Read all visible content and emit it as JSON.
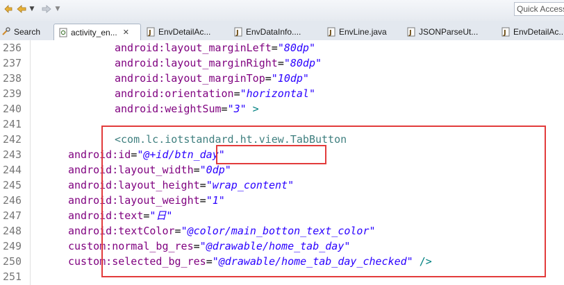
{
  "toolbar": {
    "quick_access": "Quick Access"
  },
  "tabs": [
    {
      "label": "Search",
      "icon": "search-icon",
      "active": false
    },
    {
      "label": "activity_en...",
      "icon": "xml-file-icon",
      "active": true
    },
    {
      "label": "EnvDetailAc...",
      "icon": "java-file-icon",
      "active": false
    },
    {
      "label": "EnvDataInfo....",
      "icon": "java-file-icon",
      "active": false
    },
    {
      "label": "EnvLine.java",
      "icon": "java-file-icon",
      "active": false
    },
    {
      "label": "JSONParseUt...",
      "icon": "java-file-icon",
      "active": false
    },
    {
      "label": "EnvDetailAc...",
      "icon": "java-file-icon",
      "active": false
    }
  ],
  "code_lines": [
    {
      "num": "236",
      "indent": 3,
      "attr": "android:layout_marginLeft",
      "value": "\"80dp\"",
      "suffix": ""
    },
    {
      "num": "237",
      "indent": 3,
      "attr": "android:layout_marginRight",
      "value": "\"80dp\"",
      "suffix": ""
    },
    {
      "num": "238",
      "indent": 3,
      "attr": "android:layout_marginTop",
      "value": "\"10dp\"",
      "suffix": ""
    },
    {
      "num": "239",
      "indent": 3,
      "attr": "android:orientation",
      "value": "\"horizontal\"",
      "suffix": ""
    },
    {
      "num": "240",
      "indent": 3,
      "attr": "android:weightSum",
      "value": "\"3\"",
      "suffix": " >"
    },
    {
      "num": "241",
      "indent": 0,
      "attr": "",
      "value": "",
      "suffix": ""
    },
    {
      "num": "242",
      "indent": 3,
      "tag": "<com.lc.iotstandard.ht.view.TabButton"
    },
    {
      "num": "243",
      "indent": 4,
      "attr": "android:id",
      "value": "\"@+id/btn_day\"",
      "suffix": ""
    },
    {
      "num": "244",
      "indent": 4,
      "attr": "android:layout_width",
      "value": "\"0dp\"",
      "suffix": ""
    },
    {
      "num": "245",
      "indent": 4,
      "attr": "android:layout_height",
      "value": "\"wrap_content\"",
      "suffix": ""
    },
    {
      "num": "246",
      "indent": 4,
      "attr": "android:layout_weight",
      "value": "\"1\"",
      "suffix": ""
    },
    {
      "num": "247",
      "indent": 4,
      "attr": "android:text",
      "value": "\"日\"",
      "suffix": ""
    },
    {
      "num": "248",
      "indent": 4,
      "attr": "android:textColor",
      "value": "\"@color/main_botton_text_color\"",
      "suffix": ""
    },
    {
      "num": "249",
      "indent": 4,
      "attr": "custom:normal_bg_res",
      "value": "\"@drawable/home_tab_day\"",
      "suffix": ""
    },
    {
      "num": "250",
      "indent": 4,
      "attr": "custom:selected_bg_res",
      "value": "\"@drawable/home_tab_day_checked\"",
      "suffix": " />"
    },
    {
      "num": "251",
      "indent": 0,
      "attr": "",
      "value": "",
      "suffix": ""
    }
  ],
  "colors": {
    "attribute": "#7f007f",
    "value": "#2a00ff",
    "tag": "#3f7f7f",
    "highlight_box": "#e23b3b"
  }
}
